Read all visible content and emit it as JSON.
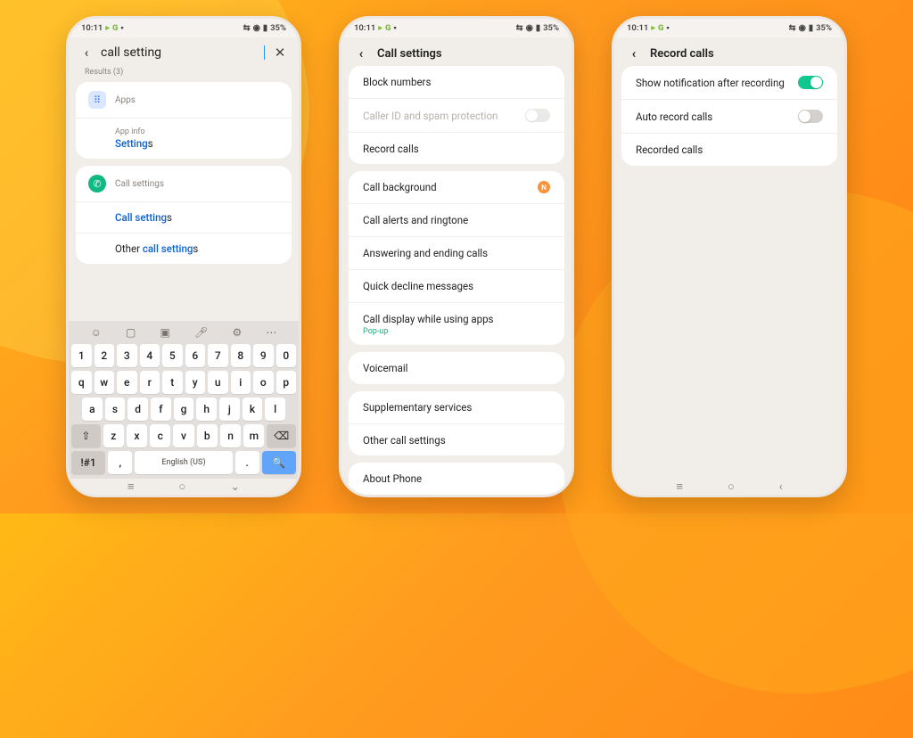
{
  "status": {
    "time": "10:11",
    "g": "G",
    "battery": "35%"
  },
  "phone1": {
    "search_value": "call setting",
    "results_label": "Results (3)",
    "apps_header": "Apps",
    "app_info": "App info",
    "app_settings_prefix": "Setting",
    "app_settings_hl": "s",
    "call_settings_header": "Call settings",
    "call_settings_prefix": "Call setting",
    "call_settings_hl": "s",
    "other_prefix": "Other ",
    "other_mid": "call setting",
    "other_hl": "s",
    "kbd": {
      "nums": [
        "1",
        "2",
        "3",
        "4",
        "5",
        "6",
        "7",
        "8",
        "9",
        "0"
      ],
      "r1": [
        "q",
        "w",
        "e",
        "r",
        "t",
        "y",
        "u",
        "i",
        "o",
        "p"
      ],
      "r2": [
        "a",
        "s",
        "d",
        "f",
        "g",
        "h",
        "j",
        "k",
        "l"
      ],
      "r3": [
        "z",
        "x",
        "c",
        "v",
        "b",
        "n",
        "m"
      ],
      "shift": "⇧",
      "bksp": "⌫",
      "sym": "!#1",
      "lang": "English (US)",
      "comma": ",",
      "period": ".",
      "search": "🔍"
    }
  },
  "phone2": {
    "title": "Call settings",
    "rows": {
      "block": "Block numbers",
      "caller_id": "Caller ID and spam protection",
      "record": "Record calls",
      "bg": "Call background",
      "alerts": "Call alerts and ringtone",
      "answer": "Answering and ending calls",
      "decline": "Quick decline messages",
      "display": "Call display while using apps",
      "display_sub": "Pop-up",
      "voicemail": "Voicemail",
      "supp": "Supplementary services",
      "other": "Other call settings",
      "about": "About Phone"
    }
  },
  "phone3": {
    "title": "Record calls",
    "rows": {
      "notif": "Show notification after recording",
      "auto": "Auto record calls",
      "recorded": "Recorded calls"
    }
  }
}
